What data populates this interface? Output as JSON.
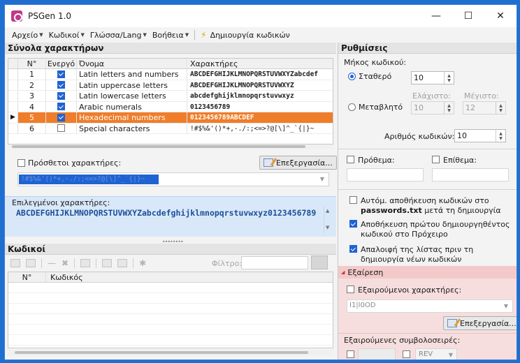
{
  "window": {
    "title": "PSGen 1.0",
    "minimize": "—",
    "maximize": "☐",
    "close": "✕"
  },
  "menu": {
    "file": "Αρχείο",
    "codes": "Κωδικοί",
    "language": "Γλώσσα/Lang",
    "help": "Βοήθεια",
    "generate": "Δημιουργία κωδικών"
  },
  "charsets": {
    "title": "Σύνολα χαρακτήρων",
    "headers": {
      "num": "N°",
      "active": "Ενεργό",
      "name": "Όνομα",
      "chars": "Χαρακτήρες"
    },
    "rows": [
      {
        "num": "1",
        "active": true,
        "name": "Latin letters and numbers",
        "chars": "ABCDEFGHIJKLMNOPQRSTUVWXYZabcdef"
      },
      {
        "num": "2",
        "active": true,
        "name": "Latin uppercase letters",
        "chars": "ABCDEFGHIJKLMNOPQRSTUVWXYZ"
      },
      {
        "num": "3",
        "active": true,
        "name": "Latin lowercase letters",
        "chars": "abcdefghijklmnopqrstuvwxyz"
      },
      {
        "num": "4",
        "active": true,
        "name": "Arabic numerals",
        "chars": "0123456789"
      },
      {
        "num": "5",
        "active": true,
        "name": "Hexadecimal numbers",
        "chars": "0123456789ABCDEF"
      },
      {
        "num": "6",
        "active": false,
        "name": "Special characters",
        "chars": "!#$%&'()*+,-./:;<=>?@[\\]^_`{|}~"
      }
    ],
    "current_marker": "▶"
  },
  "extra": {
    "label": "Πρόσθετοι χαρακτήρες:",
    "edit_button": "Επεξεργασία...",
    "value": "!#$%&'()*+,-./:;<=>?@[\\]^_`{|}~"
  },
  "selected": {
    "label": "Επιλεγμένοι χαρακτήρες:",
    "value": "ABCDEFGHIJKLMNOPQRSTUVWXYZabcdefghijklmnopqrstuvwxyz0123456789"
  },
  "codes": {
    "title": "Κωδικοί",
    "filter_label": "Φίλτρο:",
    "headers": {
      "num": "N°",
      "code": "Κωδικός"
    }
  },
  "settings": {
    "title": "Ρυθμίσεις",
    "length_label": "Μήκος κωδικού:",
    "fixed_label": "Σταθερό",
    "fixed_value": "10",
    "variable_label": "Μεταβλητό",
    "min_label": "Ελάχιστο:",
    "max_label": "Μέγιστο:",
    "min_value": "10",
    "max_value": "12",
    "count_label": "Αριθμός κωδικών:",
    "count_value": "10",
    "prefix_label": "Πρόθεμα:",
    "suffix_label": "Επίθεμα:",
    "autosave_text": "Αυτόμ. αποθήκευση κωδικών στο",
    "autosave_file": "passwords.txt",
    "autosave_after": "μετά τη δημιουργία",
    "clipboard_text": "Αποθήκευση πρώτου δημιουργηθέντος κωδικού στο Πρόχειρο",
    "clear_text": "Απαλοιφή της λίστας πριν τη δημιουργία νέων κωδικών"
  },
  "exclusion": {
    "title": "Εξαίρεση",
    "chars_label": "Εξαιρούμενοι χαρακτήρες:",
    "chars_value": "I1|l0OD",
    "edit_button": "Επεξεργασία...",
    "seq_label": "Εξαιρούμενες συμβολοσειρές:",
    "rev_label": "REV"
  }
}
